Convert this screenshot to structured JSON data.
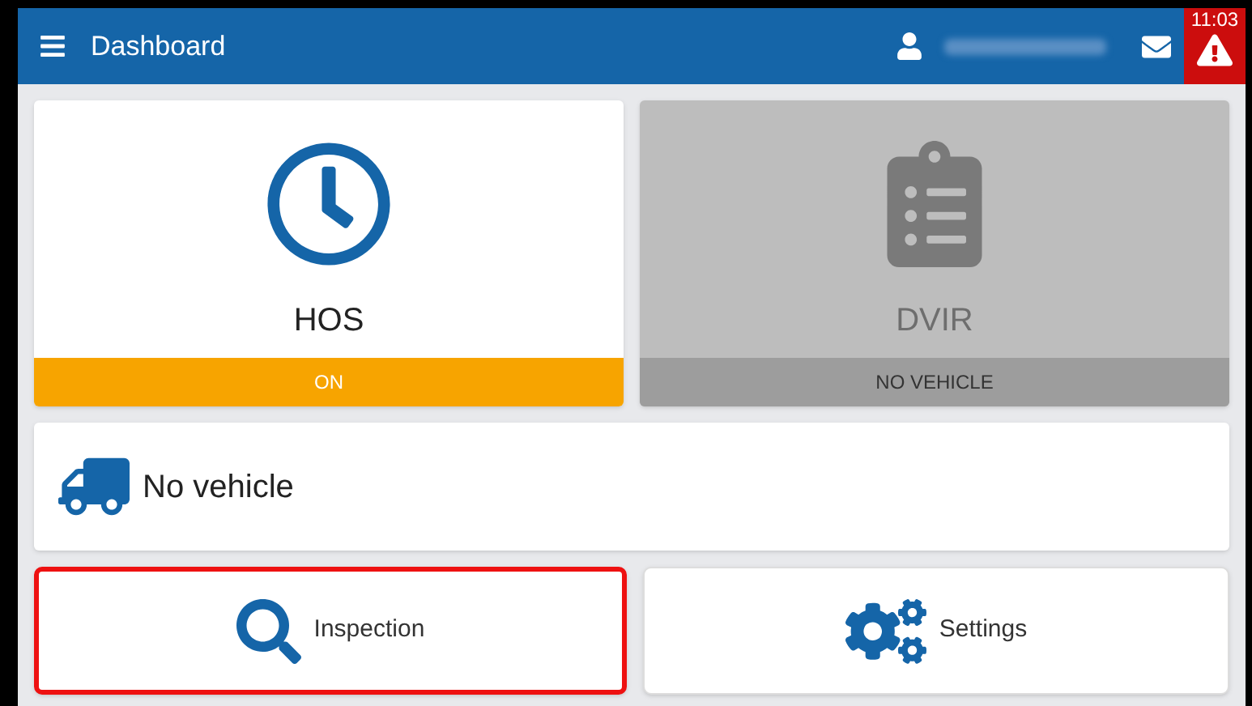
{
  "header": {
    "title": "Dashboard",
    "time": "11:03"
  },
  "tiles": [
    {
      "kind": "clock",
      "label": "HOS",
      "status": "ON",
      "enabled": true
    },
    {
      "kind": "clipboard",
      "label": "DVIR",
      "status": "NO VEHICLE",
      "enabled": false
    }
  ],
  "vehicle": {
    "label": "No vehicle"
  },
  "actions": [
    {
      "kind": "search",
      "label": "Inspection",
      "highlighted": true
    },
    {
      "kind": "gears",
      "label": "Settings",
      "highlighted": false
    }
  ]
}
